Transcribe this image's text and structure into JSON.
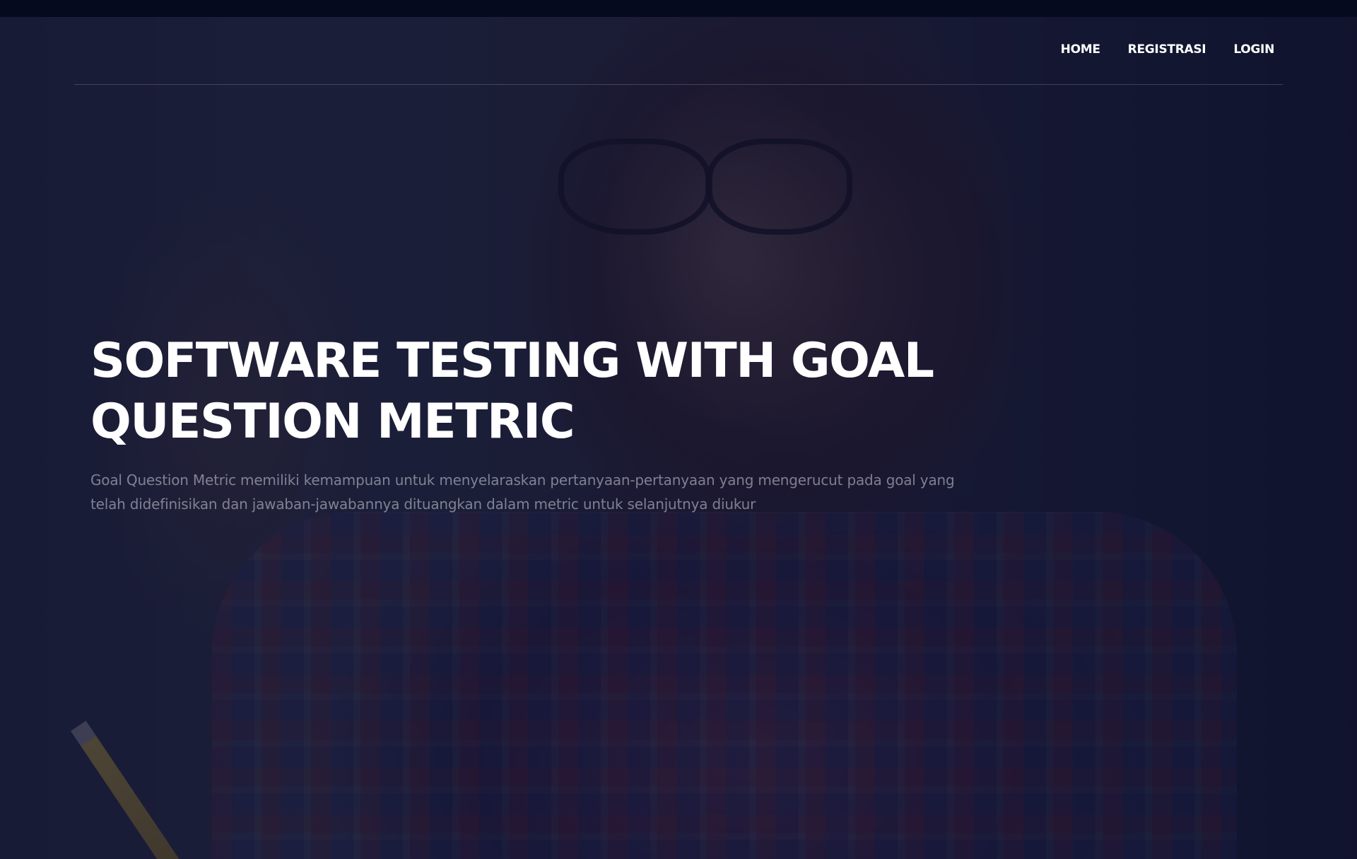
{
  "nav": {
    "items": [
      {
        "label": "HOME"
      },
      {
        "label": "REGISTRASI"
      },
      {
        "label": "LOGIN"
      }
    ]
  },
  "hero": {
    "title": "SOFTWARE TESTING WITH GOAL QUESTION METRIC",
    "subtitle": "Goal Question Metric memiliki kemampuan untuk menyelaraskan pertanyaan-pertanyaan yang mengerucut pada goal yang telah didefinisikan dan jawaban-jawabannya dituangkan dalam metric untuk selanjutnya diukur"
  },
  "colors": {
    "topbar": "#050a1e",
    "overlay": "#0e1030",
    "text_primary": "#ffffff",
    "text_muted": "#9a9aad"
  }
}
